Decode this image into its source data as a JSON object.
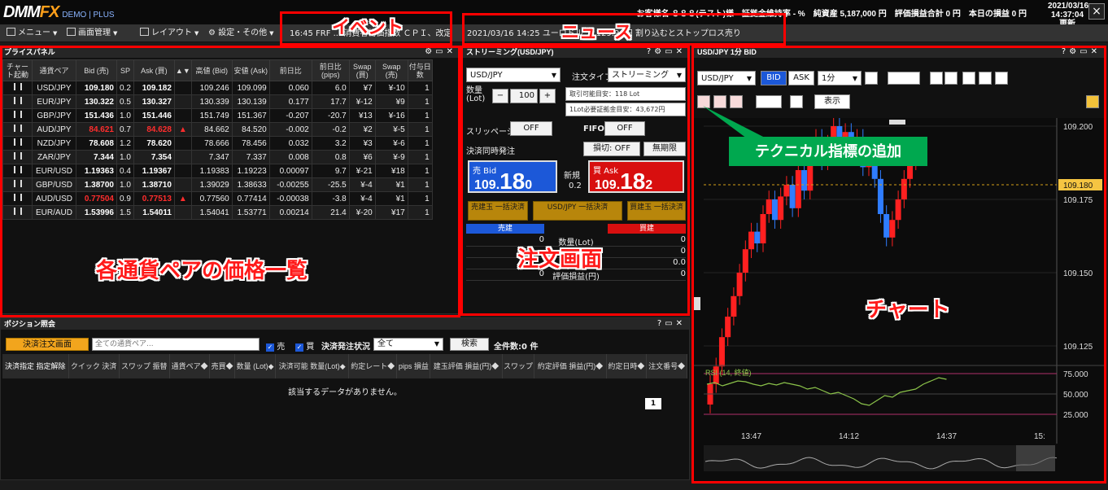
{
  "header": {
    "logo": "DMM",
    "logo_fx": "FX",
    "logo_sub": "DEMO | PLUS",
    "account_name": "お客様名 ８８８(テスト)様",
    "margin_ratio": "証拠金維持率 - %",
    "net_assets": "純資産 5,187,000 円",
    "valuation": "評価損益合計 0 円",
    "daily_pl": "本日の損益 0 円",
    "date": "2021/03/16",
    "time": "14:37:04更新",
    "close_icon": "×"
  },
  "menubar": {
    "menu": "メニュー",
    "screen": "画面管理",
    "layout": "レイアウト",
    "settings": "設定・その他",
    "event_ticker": "16:45  FRF  ... 消費者物価指数 ＣＰＩ、改定",
    "news_ticker": "2021/03/16 14:25  ユーロドル ... 129.90円  割り込むとストップロス売り"
  },
  "price_panel": {
    "title": "プライスパネル",
    "headers": [
      "チャート起動",
      "通貨ペア",
      "Bid (売)",
      "SP",
      "Ask (買)",
      "▲▼",
      "高値 (Bid)",
      "安値 (Ask)",
      "前日比",
      "前日比 (pips)",
      "Swap (買)",
      "Swap (売)",
      "付与日数"
    ],
    "rows": [
      {
        "pair": "USD/JPY",
        "bid": "109.180",
        "sp": "0.2",
        "ask": "109.182",
        "dir": "",
        "high": "109.246",
        "low": "109.099",
        "chg": "0.060",
        "pips": "6.0",
        "swap_buy": "¥7",
        "swap_sell": "¥-10",
        "days": "1",
        "red": false
      },
      {
        "pair": "EUR/JPY",
        "bid": "130.322",
        "sp": "0.5",
        "ask": "130.327",
        "dir": "",
        "high": "130.339",
        "low": "130.139",
        "chg": "0.177",
        "pips": "17.7",
        "swap_buy": "¥-12",
        "swap_sell": "¥9",
        "days": "1",
        "red": false
      },
      {
        "pair": "GBP/JPY",
        "bid": "151.436",
        "sp": "1.0",
        "ask": "151.446",
        "dir": "",
        "high": "151.749",
        "low": "151.367",
        "chg": "-0.207",
        "pips": "-20.7",
        "swap_buy": "¥13",
        "swap_sell": "¥-16",
        "days": "1",
        "red": false
      },
      {
        "pair": "AUD/JPY",
        "bid": "84.621",
        "sp": "0.7",
        "ask": "84.628",
        "dir": "▲",
        "high": "84.662",
        "low": "84.520",
        "chg": "-0.002",
        "pips": "-0.2",
        "swap_buy": "¥2",
        "swap_sell": "¥-5",
        "days": "1",
        "red": true
      },
      {
        "pair": "NZD/JPY",
        "bid": "78.608",
        "sp": "1.2",
        "ask": "78.620",
        "dir": "",
        "high": "78.666",
        "low": "78.456",
        "chg": "0.032",
        "pips": "3.2",
        "swap_buy": "¥3",
        "swap_sell": "¥-6",
        "days": "1",
        "red": false
      },
      {
        "pair": "ZAR/JPY",
        "bid": "7.344",
        "sp": "1.0",
        "ask": "7.354",
        "dir": "",
        "high": "7.347",
        "low": "7.337",
        "chg": "0.008",
        "pips": "0.8",
        "swap_buy": "¥6",
        "swap_sell": "¥-9",
        "days": "1",
        "red": false
      },
      {
        "pair": "EUR/USD",
        "bid": "1.19363",
        "sp": "0.4",
        "ask": "1.19367",
        "dir": "",
        "high": "1.19383",
        "low": "1.19223",
        "chg": "0.00097",
        "pips": "9.7",
        "swap_buy": "¥-21",
        "swap_sell": "¥18",
        "days": "1",
        "red": false
      },
      {
        "pair": "GBP/USD",
        "bid": "1.38700",
        "sp": "1.0",
        "ask": "1.38710",
        "dir": "",
        "high": "1.39029",
        "low": "1.38633",
        "chg": "-0.00255",
        "pips": "-25.5",
        "swap_buy": "¥-4",
        "swap_sell": "¥1",
        "days": "1",
        "red": false
      },
      {
        "pair": "AUD/USD",
        "bid": "0.77504",
        "sp": "0.9",
        "ask": "0.77513",
        "dir": "▲",
        "high": "0.77560",
        "low": "0.77414",
        "chg": "-0.00038",
        "pips": "-3.8",
        "swap_buy": "¥-4",
        "swap_sell": "¥1",
        "days": "1",
        "red": true
      },
      {
        "pair": "EUR/AUD",
        "bid": "1.53996",
        "sp": "1.5",
        "ask": "1.54011",
        "dir": "",
        "high": "1.54041",
        "low": "1.53771",
        "chg": "0.00214",
        "pips": "21.4",
        "swap_buy": "¥-20",
        "swap_sell": "¥17",
        "days": "1",
        "red": false
      }
    ]
  },
  "order": {
    "title": "ストリーミング(USD/JPY)",
    "pair": "USD/JPY",
    "order_type_label": "注文タイプ",
    "order_type": "ストリーミング",
    "qty_label": "数量 (Lot)",
    "qty": "100",
    "minus": "−",
    "plus": "+",
    "tradable": "取引可能目安：118 Lot",
    "margin": "1Lot必要証拠金目安：43,672円",
    "slippage_label": "スリッページ",
    "slippage": "OFF",
    "fifo_label": "FIFO",
    "fifo": "OFF",
    "settle_label": "決済同時発注",
    "stop": "損切: OFF",
    "expiry": "無期限",
    "sell_label": "売 Bid",
    "sell_head": "109.",
    "sell_big": "18",
    "sell_tail": "0",
    "spread_label": "新規",
    "spread": "0.2",
    "buy_label": "買 Ask",
    "buy_head": "109.",
    "buy_big": "18",
    "buy_tail": "2",
    "btn_sell_all": "売建玉 一括決済",
    "btn_pair_all": "USD/JPY 一括決済",
    "btn_buy_all": "買建玉 一括決済",
    "col_sell": "売建",
    "col_buy": "買建",
    "rows": [
      {
        "sell": "0",
        "label": "数量(Lot)",
        "buy": "0"
      },
      {
        "sell": "",
        "label": "平均建値",
        "buy": "0"
      },
      {
        "sell": "",
        "label": "pips損益",
        "buy": "0.0"
      },
      {
        "sell": "0",
        "label": "評価損益(円)",
        "buy": "0"
      }
    ]
  },
  "positions": {
    "title": "ポジション照会",
    "settle_btn": "決済注文画面",
    "search_placeholder": "全ての通貨ペア...",
    "chk_sell": "売",
    "chk_buy": "買",
    "status_label": "決済発注状況",
    "status": "全て",
    "search_btn": "検索",
    "count": "全件数:0 件",
    "headers": [
      "決済指定 指定解除",
      "クイック 決済",
      "スワップ 振替",
      "通貨ペア◆",
      "売買◆",
      "数量 (Lot)◆",
      "決済可能 数量(Lot)◆",
      "約定レート◆",
      "pips 損益",
      "建玉評価 損益(円)◆",
      "スワップ",
      "約定評価 損益(円)◆",
      "約定日時◆",
      "注文番号◆"
    ],
    "empty": "該当するデータがありません。",
    "page": "1"
  },
  "chart": {
    "title": "USD/JPY 1分 BID",
    "pair": "USD/JPY",
    "bid": "BID",
    "ask": "ASK",
    "timeframe": "1分",
    "display": "表示",
    "current": "109.180",
    "yticks": [
      "109.200",
      "109.175",
      "109.150",
      "109.125"
    ],
    "rsi_label": "RSI (14, 終値)",
    "rsi_ticks": [
      "75.000",
      "50.000",
      "25.000"
    ],
    "xticks": [
      "13:47",
      "14:12",
      "14:37",
      "15:"
    ],
    "candle_colors": {
      "up": "#ff2020",
      "down": "#2f7dff"
    }
  },
  "annotations": {
    "event": "イベント",
    "news": "ニュース",
    "prices": "各通貨ペアの価格一覧",
    "order": "注文画面",
    "chart": "チャート",
    "indicator": "テクニカル指標の追加"
  }
}
